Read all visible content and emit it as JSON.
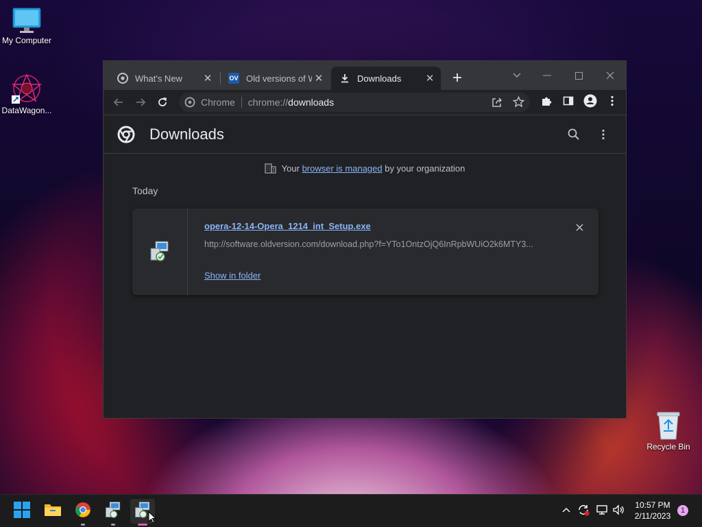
{
  "desktop": {
    "icons": [
      {
        "label": "My Computer"
      },
      {
        "label": "DataWagon..."
      },
      {
        "label": "Recycle Bin"
      }
    ]
  },
  "browser": {
    "tabs": [
      {
        "label": "What's New",
        "icon": "chrome-icon",
        "active": false
      },
      {
        "label": "Old versions of Wi",
        "icon": "ov-icon",
        "icon_text": "OV",
        "active": false
      },
      {
        "label": "Downloads",
        "icon": "download-icon",
        "active": true
      }
    ],
    "address_bar": {
      "site_label": "Chrome",
      "url_prefix": "chrome://",
      "url_host": "downloads"
    },
    "page": {
      "title": "Downloads",
      "managed_notice": {
        "prefix": "Your",
        "link": "browser is managed",
        "suffix": "by your organization"
      },
      "section_label": "Today",
      "download": {
        "filename": "opera-12-14-Opera_1214_int_Setup.exe",
        "url": "http://software.oldversion.com/download.php?f=YTo1OntzOjQ6InRpbWUiO2k6MTY3...",
        "action": "Show in folder"
      }
    }
  },
  "taskbar": {
    "clock_time": "10:57 PM",
    "clock_date": "2/11/2023",
    "notification_count": "1"
  },
  "colors": {
    "accent_link": "#8ab4f8",
    "window_bg": "#202124",
    "tabstrip_bg": "#35363a",
    "taskbar_bg": "#1c1c1c"
  }
}
